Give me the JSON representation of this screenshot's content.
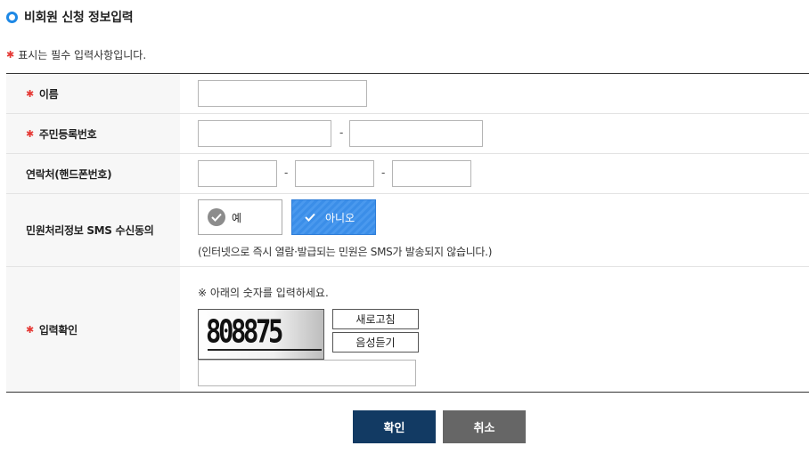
{
  "section": {
    "title": "비회원 신청 정보입력"
  },
  "required_note": {
    "star": "✱",
    "text": "표시는 필수 입력사항입니다."
  },
  "form": {
    "required_star": "✱",
    "name_label": "이름",
    "ssn_label": "주민등록번호",
    "phone_label": "연락처(핸드폰번호)",
    "sms_label": "민원처리정보 SMS 수신동의",
    "captcha_label": "입력확인",
    "dash": "-",
    "sms_yes": "예",
    "sms_no": "아니오",
    "sms_selected": "아니오",
    "sms_note": "(인터넷으로 즉시 열람·발급되는 민원은 SMS가 발송되지 않습니다.)",
    "captcha_note": "※ 아래의 숫자를 입력하세요.",
    "captcha_code": "808875",
    "refresh_label": "새로고침",
    "audio_label": "음성듣기"
  },
  "actions": {
    "confirm": "확인",
    "cancel": "취소"
  },
  "colors": {
    "accent": "#1e88e5",
    "required": "#e53935",
    "confirm_bg": "#123a63",
    "cancel_bg": "#666666",
    "selected_radio": "#3b8ee8"
  },
  "icons": {
    "title_bullet": "circle-outline-icon",
    "check": "check-icon"
  }
}
